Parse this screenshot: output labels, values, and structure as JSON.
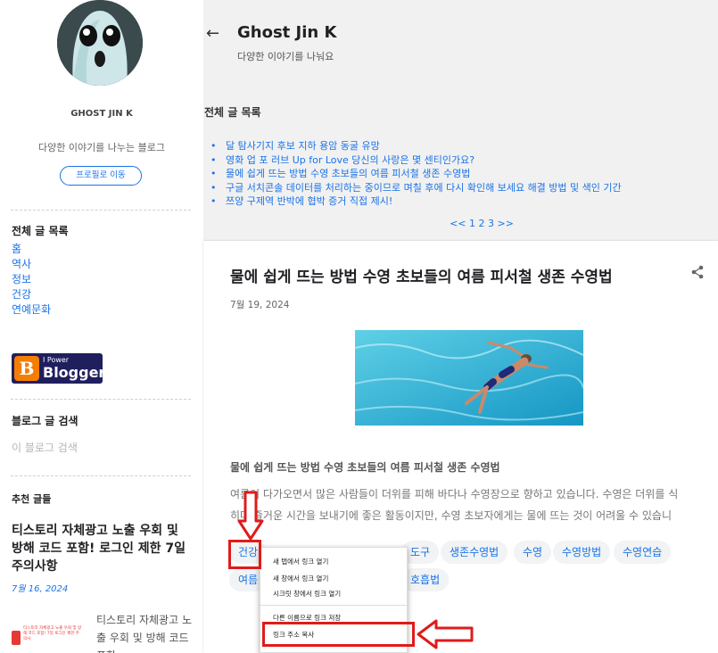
{
  "sidebar": {
    "name": "GHOST JIN K",
    "description": "다양한 이야기를 나누는 블로그",
    "profile_button": "프로필로 이동",
    "all_posts_heading": "전체 글 목록",
    "links": [
      "홈",
      "역사",
      "정보",
      "건강",
      "연예문화"
    ],
    "blogger_badge_small": "I Power",
    "blogger_badge_big": "Blogger",
    "blogger_badge_letter": "B",
    "search_heading": "블로그 글 검색",
    "search_placeholder": "이 블로그 검색",
    "recommended_heading": "추천 글들",
    "recommended_title": "티스토리 자체광고 노출 우회 및 방해 코드 포함! 로그인 제한 7일 주의사항",
    "recommended_date": "7월 16, 2024",
    "recommended_thumb_text": "티스토리 자체광고 노출 우회 및 방해 코드 포함! 7일 로그인 제한 주의사",
    "recommended_excerpt": "티스토리 자체광고 노출 우회 및 방해 코드 포함"
  },
  "header": {
    "back_icon": "arrow-left-icon",
    "title": "Ghost Jin K",
    "subtitle": "다양한 이야기를 나눠요"
  },
  "post_list": {
    "heading": "전체 글 목록",
    "items": [
      "달 탐사기지 후보 지하 용암 동굴 유망",
      "영화 업 포 러브 Up for Love 당신의 사랑은 몇 센티인가요?",
      "물에 쉽게 뜨는 방법 수영 초보들의 여름 피서철 생존 수영법",
      "구글 서치콘솔 데이터를 처리하는 중이므로 며칠 후에 다시 확인해 보세요 해결 방법 및 색인 기간",
      "쯔양 구제역 반박에 협박 증거 직접 제시!"
    ],
    "pagination": "<< 1 2 3 >>"
  },
  "post": {
    "title": "물에 쉽게 뜨는 방법 수영 초보들의 여름 피서철 생존 수영법",
    "share_icon": "share-icon",
    "date": "7월 19, 2024",
    "subheading": "물에 쉽게 뜨는 방법 수영 초보들의 여름 피서철 생존 수영법",
    "body_line1": "여름이 다가오면서 많은 사람들이 더위를 피해 바다나 수영장으로 향하고 있습니다. 수영은 더위를 식",
    "body_line2": "히며 즐거운 시간을 보내기에 좋은 활동이지만, 수영 초보자에게는 물에 뜨는 것이 어려울 수 있습니",
    "tags_row1": [
      "건강",
      "도구",
      "생존수영법",
      "수영",
      "수영방법",
      "수영연습"
    ],
    "tags_row2": [
      "여름",
      "호흡법"
    ]
  },
  "context_menu": {
    "items": [
      "새 탭에서 링크 열기",
      "새 창에서 링크 열기",
      "시크릿 창에서 링크 열기",
      "다른 이름으로 링크 저장",
      "링크 주소 복사"
    ]
  },
  "colors": {
    "link": "#1a73e8",
    "annotation_red": "#e01b1b",
    "page_bg": "#f1f1f1"
  }
}
